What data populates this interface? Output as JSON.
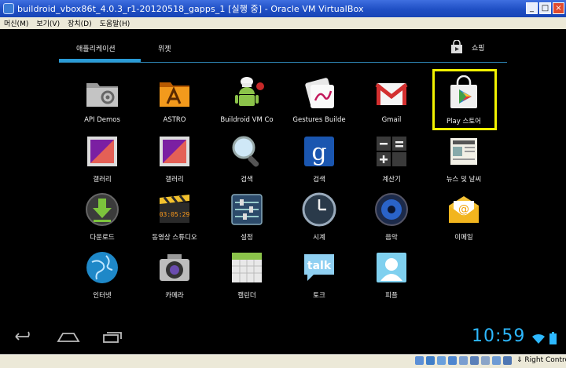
{
  "window": {
    "title": "buildroid_vbox86t_4.0.3_r1-20120518_gapps_1 [실행 중] - Oracle VM VirtualBox",
    "menu": [
      "머신(M)",
      "보기(V)",
      "장치(D)",
      "도움말(H)"
    ],
    "host_key": "Right Control"
  },
  "launcher": {
    "tabs": {
      "apps": "애플리케이션",
      "widgets": "위젯"
    },
    "shop_label": "쇼핑",
    "apps": [
      {
        "label": "API Demos",
        "icon": "folder-gear-icon"
      },
      {
        "label": "ASTRO",
        "icon": "astro-folder-icon"
      },
      {
        "label": "Buildroid VM Co",
        "icon": "android-chef-icon"
      },
      {
        "label": "Gestures Builde",
        "icon": "gestures-icon"
      },
      {
        "label": "Gmail",
        "icon": "gmail-icon"
      },
      {
        "label": "Play 스토어",
        "icon": "play-store-icon"
      },
      {
        "label": "갤러리",
        "icon": "gallery-icon"
      },
      {
        "label": "갤러리",
        "icon": "gallery-icon"
      },
      {
        "label": "검색",
        "icon": "magnifier-icon"
      },
      {
        "label": "검색",
        "icon": "google-search-icon"
      },
      {
        "label": "계산기",
        "icon": "calculator-icon"
      },
      {
        "label": "뉴스 및 날씨",
        "icon": "news-weather-icon"
      },
      {
        "label": "다운로드",
        "icon": "download-icon"
      },
      {
        "label": "동영상 스튜디오",
        "icon": "movie-studio-icon"
      },
      {
        "label": "설정",
        "icon": "settings-icon"
      },
      {
        "label": "시계",
        "icon": "clock-icon"
      },
      {
        "label": "음악",
        "icon": "music-icon"
      },
      {
        "label": "이메일",
        "icon": "email-icon"
      },
      {
        "label": "인터넷",
        "icon": "browser-globe-icon"
      },
      {
        "label": "카메라",
        "icon": "camera-icon"
      },
      {
        "label": "캘린더",
        "icon": "calendar-icon"
      },
      {
        "label": "토크",
        "icon": "talk-icon"
      },
      {
        "label": "피플",
        "icon": "people-icon"
      }
    ],
    "highlighted_app": "Play 스토어"
  },
  "navigation": {
    "buttons": [
      "back-icon",
      "home-icon",
      "recent-apps-icon"
    ],
    "clock": "10:59",
    "accent_color": "#2db8ff"
  }
}
